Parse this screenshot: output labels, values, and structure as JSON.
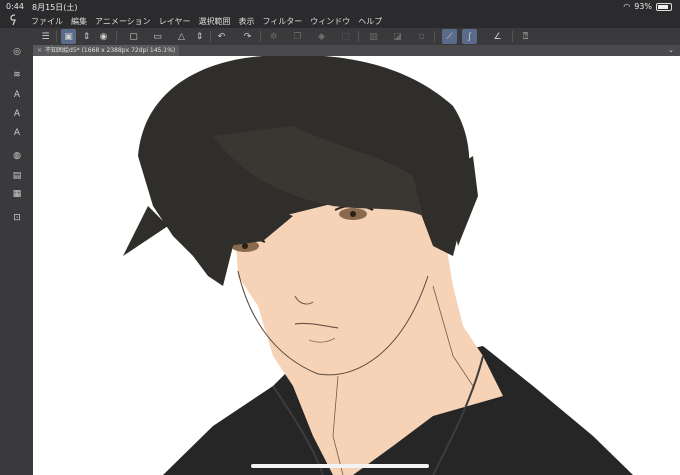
{
  "status": {
    "time": "0:44",
    "date": "8月15日(土)",
    "battery": "93%"
  },
  "menu": [
    "ファイル",
    "編集",
    "アニメーション",
    "レイヤー",
    "選択範囲",
    "表示",
    "フィルター",
    "ウィンドウ",
    "ヘルプ"
  ],
  "tab": {
    "close": "×",
    "title": "不知囲絵d5* (1668 x 2388px 72dpi 145.1%)"
  },
  "colors": {
    "skin": "#f6d3b7",
    "hair": "#302e2a",
    "shirt": "#262626",
    "canvas": "#ffffff",
    "ui": "#3a3a3c",
    "active": "#5b6b8c"
  }
}
